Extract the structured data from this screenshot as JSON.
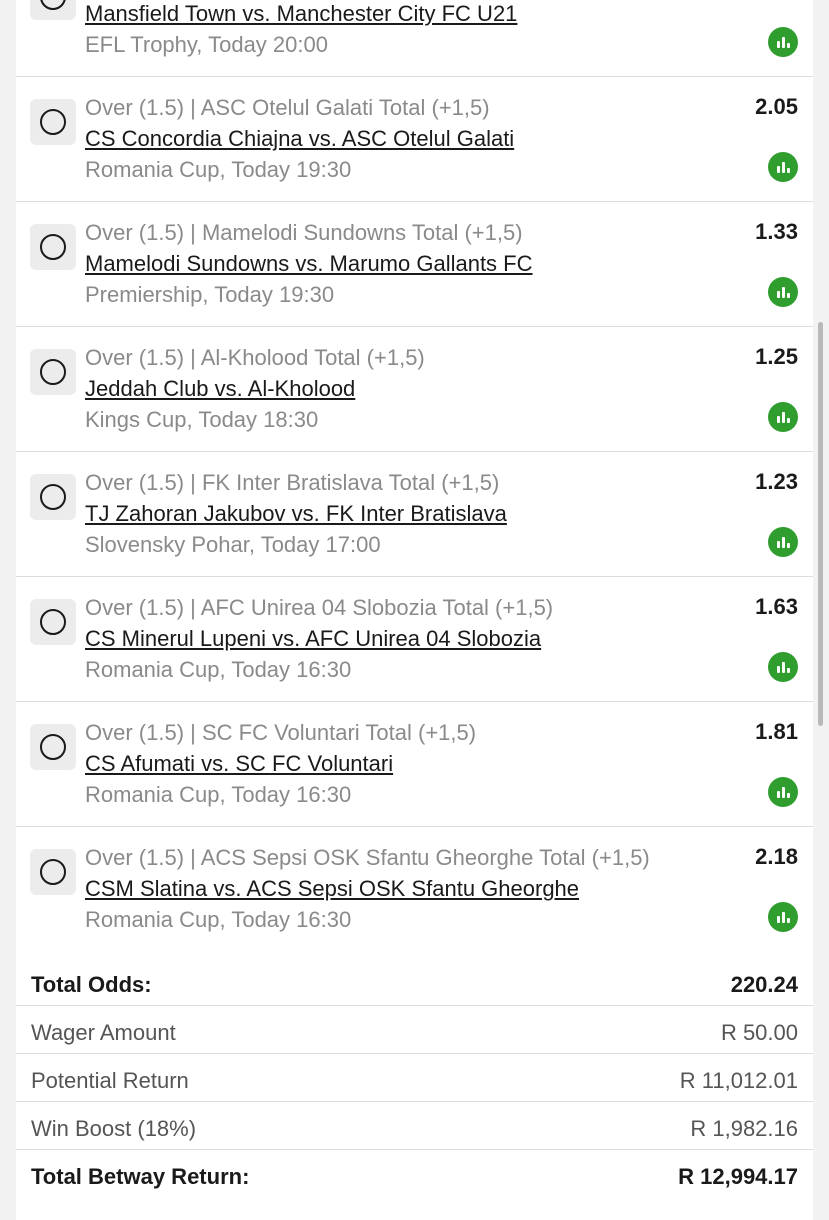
{
  "bets": [
    {
      "market": "",
      "match": "Mansfield Town vs. Manchester City FC U21",
      "meta": "EFL Trophy, Today 20:00",
      "odds": ""
    },
    {
      "market": "Over (1.5) | ASC Otelul Galati Total (+1,5)",
      "match": "CS Concordia Chiajna vs. ASC Otelul Galati",
      "meta": "Romania Cup, Today 19:30",
      "odds": "2.05"
    },
    {
      "market": "Over (1.5) | Mamelodi Sundowns Total (+1,5)",
      "match": "Mamelodi Sundowns vs. Marumo Gallants FC",
      "meta": "Premiership, Today 19:30",
      "odds": "1.33"
    },
    {
      "market": "Over (1.5) | Al-Kholood Total (+1,5)",
      "match": "Jeddah Club vs. Al-Kholood",
      "meta": "Kings Cup, Today 18:30",
      "odds": "1.25"
    },
    {
      "market": "Over (1.5) | FK Inter Bratislava Total (+1,5)",
      "match": "TJ Zahoran Jakubov vs. FK Inter Bratislava",
      "meta": "Slovensky Pohar, Today 17:00",
      "odds": "1.23"
    },
    {
      "market": "Over (1.5) | AFC Unirea 04 Slobozia Total (+1,5)",
      "match": "CS Minerul Lupeni vs. AFC Unirea 04 Slobozia",
      "meta": "Romania Cup, Today 16:30",
      "odds": "1.63"
    },
    {
      "market": "Over (1.5) | SC FC Voluntari Total (+1,5)",
      "match": "CS Afumati vs. SC FC Voluntari",
      "meta": "Romania Cup, Today 16:30",
      "odds": "1.81"
    },
    {
      "market": "Over (1.5) | ACS Sepsi OSK Sfantu Gheorghe Total (+1,5)",
      "match": "CSM Slatina vs. ACS Sepsi OSK Sfantu Gheorghe",
      "meta": "Romania Cup, Today 16:30",
      "odds": "2.18"
    }
  ],
  "summary": {
    "total_odds_label": "Total Odds:",
    "total_odds_value": "220.24",
    "wager_label": "Wager Amount",
    "wager_value": "R 50.00",
    "potential_label": "Potential Return",
    "potential_value": "R 11,012.01",
    "boost_label": "Win Boost (18%)",
    "boost_value": "R 1,982.16",
    "total_return_label": "Total Betway Return:",
    "total_return_value": "R 12,994.17"
  },
  "colors": {
    "accent_green": "#2f9e2f",
    "text_dark": "#1a1a1a",
    "text_muted": "#8a8a8a"
  },
  "icons": {
    "selection": "radio-circle-icon",
    "stats": "bar-chart-icon"
  }
}
